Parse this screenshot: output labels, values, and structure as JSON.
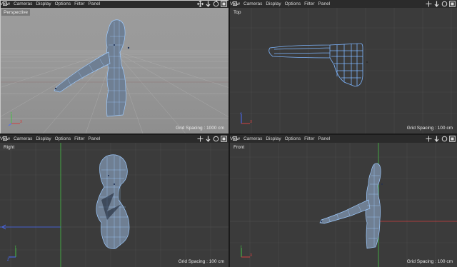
{
  "menu": [
    "View",
    "Cameras",
    "Display",
    "Options",
    "Filter",
    "Panel"
  ],
  "viewports": {
    "perspective": {
      "name": "Perspective",
      "grid": "Grid Spacing : 1000 cm"
    },
    "top": {
      "name": "Top",
      "grid": "Grid Spacing : 100 cm"
    },
    "right": {
      "name": "Right",
      "grid": "Grid Spacing : 100 cm"
    },
    "front": {
      "name": "Front",
      "grid": "Grid Spacing : 100 cm"
    }
  },
  "axis_labels": {
    "y": "Y",
    "x": "X",
    "z": "Z"
  },
  "tool_icons": [
    "move-view-icon",
    "dolly-view-icon",
    "rotate-view-icon",
    "maximize-view-icon"
  ],
  "colors": {
    "mesh": "#7eb6ff",
    "axis_x": "#d04040",
    "axis_y": "#46c046",
    "axis_z": "#4b6dff"
  }
}
